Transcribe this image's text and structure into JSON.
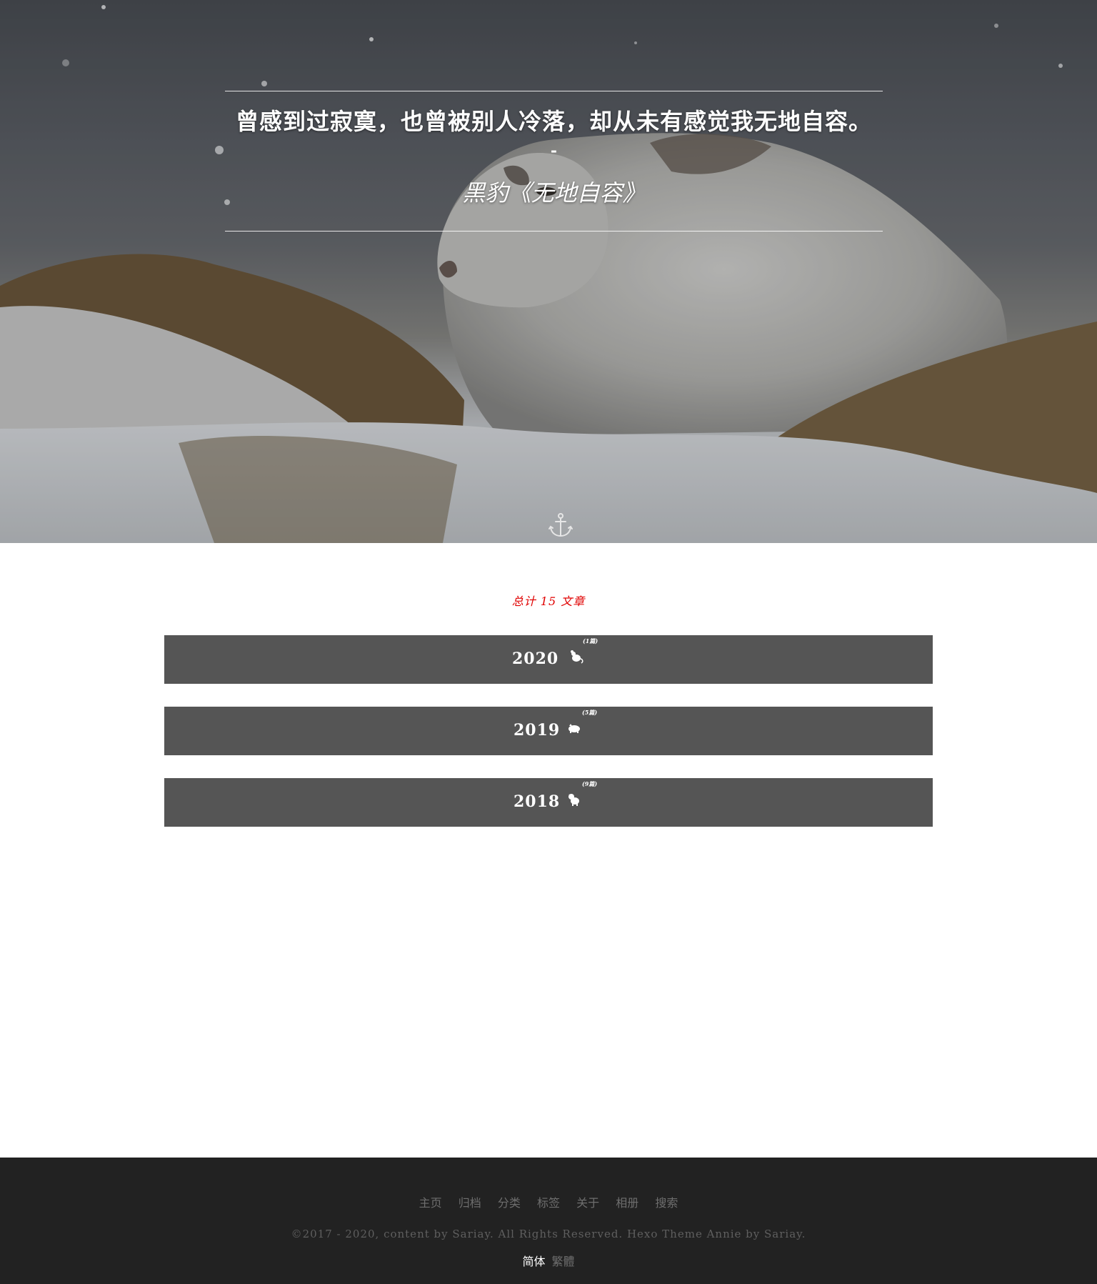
{
  "hero": {
    "quote": "曾感到过寂寞，也曾被别人冷落，却从未有感觉我无地自容。",
    "dash": "-",
    "author": "黑豹《无地自容》",
    "anchor_icon": "anchor-icon"
  },
  "archive": {
    "total_label": "总计 15 文章",
    "years": [
      {
        "year": "2020",
        "count": "(1篇)",
        "zodiac_icon": "rat-icon"
      },
      {
        "year": "2019",
        "count": "(5篇)",
        "zodiac_icon": "pig-icon"
      },
      {
        "year": "2018",
        "count": "(9篇)",
        "zodiac_icon": "dog-icon"
      }
    ]
  },
  "footer": {
    "nav": [
      "主页",
      "归档",
      "分类",
      "标签",
      "关于",
      "相册",
      "搜索"
    ],
    "copyright": "©2017 - 2020, content by Sariay. All Rights Reserved. Hexo Theme Annie by Sariay.",
    "lang_simplified": "简体",
    "lang_traditional": "繁體"
  },
  "colors": {
    "accent_total": "#e00000",
    "year_bar": "#555555",
    "footer_bg": "#222222"
  }
}
